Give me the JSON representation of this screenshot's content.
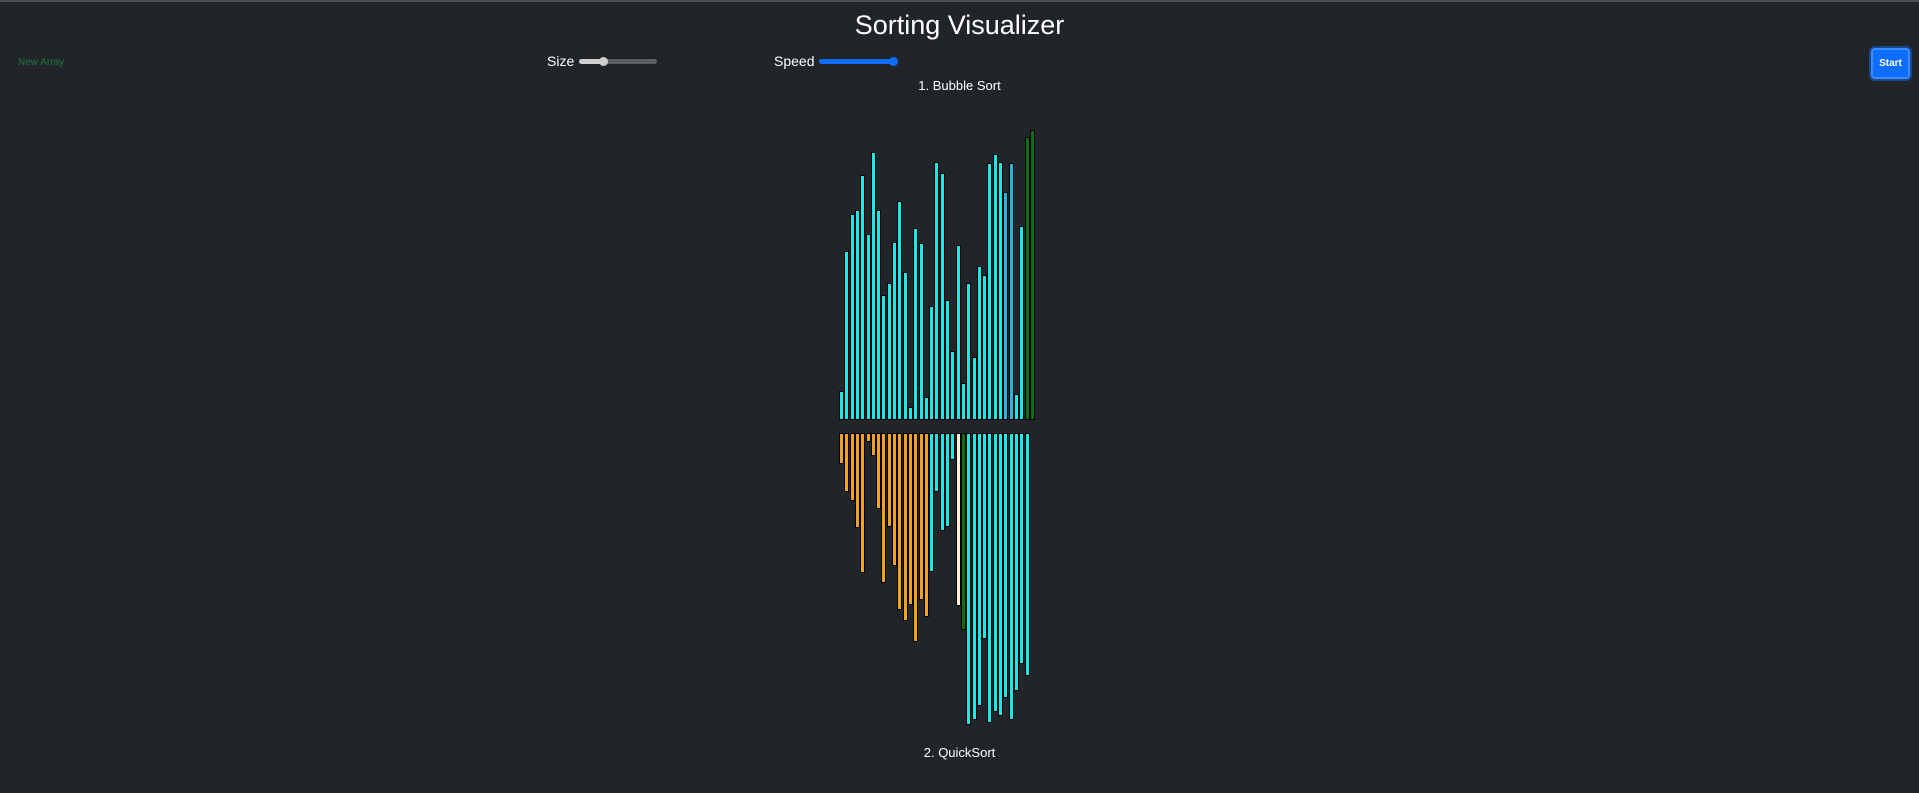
{
  "app": {
    "title": "Sorting Visualizer"
  },
  "controls": {
    "new_array_label": "New Array",
    "size_label": "Size",
    "size_value": 0.3,
    "speed_label": "Speed",
    "speed_value": 1.0,
    "start_label": "Start"
  },
  "sections": {
    "bubble_label": "1. Bubble Sort",
    "quick_label": "2. QuickSort"
  },
  "colors": {
    "bar_default": "#1de8e8",
    "bar_compare": "#2ab4de",
    "bar_sorted": "#0f6e0f",
    "bar_partition": "#f3a21d",
    "bar_pivot": "#fdf2d9",
    "slider_size": "#cfcfcf",
    "slider_speed": "#0d6efd"
  },
  "chart_data": [
    {
      "type": "bar",
      "name": "bubble_sort_bars",
      "values": [
        29,
        169,
        206,
        210,
        245,
        186,
        268,
        210,
        125,
        137,
        178,
        219,
        148,
        13,
        192,
        177,
        23,
        114,
        258,
        247,
        120,
        69,
        175,
        37,
        137,
        63,
        154,
        145,
        257,
        266,
        258,
        228,
        257,
        26,
        194,
        283,
        290
      ],
      "states": [
        "d",
        "d",
        "d",
        "d",
        "d",
        "d",
        "d",
        "d",
        "d",
        "d",
        "d",
        "d",
        "d",
        "d",
        "d",
        "d",
        "d",
        "d",
        "d",
        "d",
        "d",
        "d",
        "d",
        "d",
        "d",
        "d",
        "d",
        "d",
        "d",
        "d",
        "d",
        "c",
        "c",
        "d",
        "d",
        "s",
        "s"
      ]
    },
    {
      "type": "bar",
      "name": "quicksort_bars",
      "values": [
        31,
        59,
        68,
        95,
        140,
        9,
        23,
        76,
        150,
        94,
        133,
        177,
        188,
        172,
        209,
        167,
        184,
        139,
        59,
        98,
        94,
        27,
        173,
        197,
        292,
        287,
        273,
        206,
        290,
        279,
        283,
        265,
        287,
        258,
        231,
        243
      ],
      "states": [
        "p",
        "p",
        "p",
        "p",
        "p",
        "p",
        "p",
        "p",
        "p",
        "p",
        "p",
        "p",
        "p",
        "p",
        "p",
        "p",
        "p",
        "d",
        "d",
        "d",
        "d",
        "d",
        "v",
        "s",
        "d",
        "d",
        "d",
        "d",
        "d",
        "d",
        "d",
        "d",
        "d",
        "d",
        "d",
        "d"
      ]
    }
  ]
}
